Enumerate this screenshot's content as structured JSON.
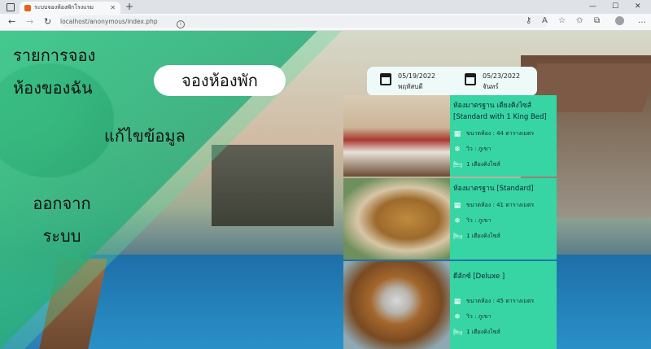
{
  "browser": {
    "tab_title": "ระบบจองห้องพักโรงแรม",
    "url": "localhost/anonymous/index.php"
  },
  "sidebar": {
    "menu_line1": "รายการจอง",
    "menu_line2": "ห้องของฉัน",
    "edit_label": "แก้ไขข้อมูล",
    "logout_line1": "ออกจาก",
    "logout_line2": "ระบบ"
  },
  "booking": {
    "button_label": "จองห้องพัก",
    "checkin_date": "05/19/2022",
    "checkin_day": "พฤหัสบดี",
    "checkout_date": "05/23/2022",
    "checkout_day": "จันทร์"
  },
  "rooms": [
    {
      "title": "ห้องมาตรฐาน เตียงคิงไซส์ [Standard with 1 King Bed]",
      "size": "ขนาดห้อง : 44 ตารางเมตร",
      "view": "วิว : ภูเขา",
      "bed": "1 เตียงคิงไซส์"
    },
    {
      "title": "ห้องมาตรฐาน [Standard]",
      "size": "ขนาดห้อง : 41 ตารางเมตร",
      "view": "วิว : ภูเขา",
      "bed": "1 เตียงคิงไซส์"
    },
    {
      "title": "ดีลักซ์ [Deluxe ]",
      "size": "ขนาดห้อง : 45 ตารางเมตร",
      "view": "วิว : ภูเขา",
      "bed": "1 เตียงคิงไซส์"
    }
  ],
  "colors": {
    "accent_green": "#37d5a3",
    "sidebar_green": "#2faa78"
  },
  "icons": [
    "calendar-icon",
    "room-size-icon",
    "snowflake-icon",
    "bed-icon"
  ]
}
